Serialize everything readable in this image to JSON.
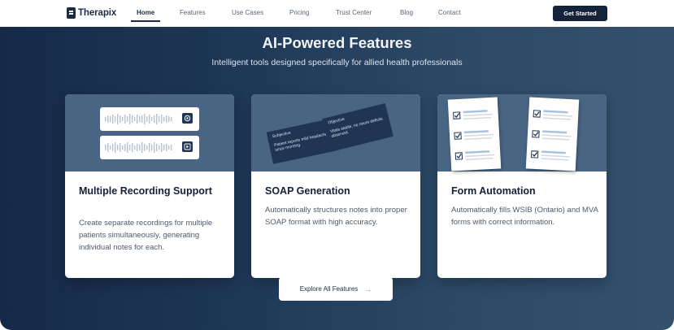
{
  "brand": {
    "name": "Therapix"
  },
  "nav": {
    "links": [
      "Home",
      "Features",
      "Use Cases",
      "Pricing",
      "Trust Center",
      "Blog",
      "Contact"
    ],
    "active": "Home",
    "cta": "Get Started"
  },
  "hero": {
    "title": "AI-Powered Features",
    "subtitle": "Intelligent tools designed specifically for allied health professionals"
  },
  "cards": [
    {
      "title": "Multiple Recording Support",
      "description": "Create separate recordings for multiple patients simultaneously, generating individual notes for each.",
      "illustration": {
        "buttons": [
          "record-icon",
          "play-icon"
        ]
      }
    },
    {
      "title": "SOAP Generation",
      "description": "Automatically structures notes into proper SOAP format with high accuracy.",
      "illustration": {
        "notes": [
          {
            "heading": "Subjective",
            "body": "Patient reports mild headache since morning."
          },
          {
            "heading": "Objective",
            "body": "Vitals stable, no neuro deficits observed."
          }
        ]
      }
    },
    {
      "title": "Form Automation",
      "description": "Automatically fills WSIB (Ontario) and MVA forms with correct information.",
      "illustration": {
        "icons": [
          "checkbox-icon"
        ]
      }
    }
  ],
  "footer_button": {
    "label": "Explore All Features",
    "icon": "arrow-right-icon"
  },
  "colors": {
    "primary": "#15233a",
    "hero_start": "#152a48",
    "hero_end": "#34506d",
    "card_image_bg": "#4a6583"
  }
}
